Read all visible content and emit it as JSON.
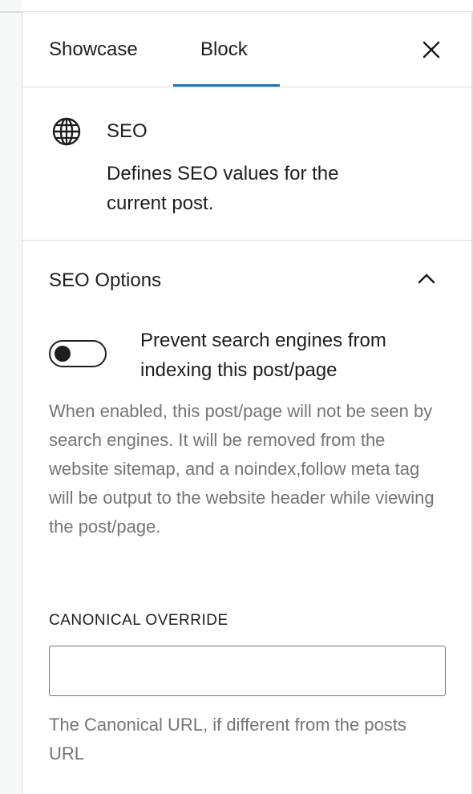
{
  "tabs": [
    {
      "label": "Showcase",
      "active": false
    },
    {
      "label": "Block",
      "active": true
    }
  ],
  "header": {
    "close_icon": "close-icon"
  },
  "block": {
    "icon": "globe-icon",
    "title": "SEO",
    "description": "Defines SEO values for the current post."
  },
  "seo_options": {
    "title": "SEO Options",
    "expanded": true,
    "toggle": {
      "checked": false,
      "label": "Prevent search engines from indexing this post/page",
      "help": "When enabled, this post/page will not be seen by search engines. It will be removed from the website sitemap, and a noindex,follow meta tag will be output to the website header while viewing the post/page."
    },
    "canonical": {
      "label": "Canonical Override",
      "value": "",
      "help": "The Canonical URL, if different from the posts URL"
    }
  },
  "colors": {
    "accent": "#2271b1",
    "text": "#1e1e1e",
    "muted": "#757575",
    "border": "#dcdcde"
  }
}
